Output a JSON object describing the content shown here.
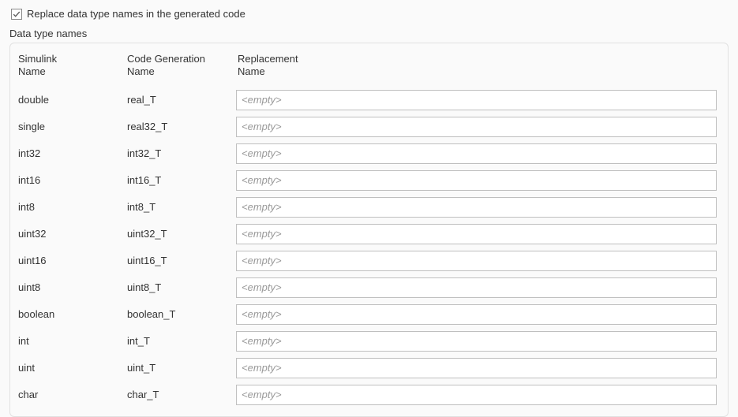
{
  "checkbox": {
    "label": "Replace data type names in the generated code",
    "checked": true
  },
  "section_title": "Data type names",
  "columns": {
    "simulink_l1": "Simulink",
    "simulink_l2": "Name",
    "codegen_l1": "Code Generation",
    "codegen_l2": "Name",
    "replacement_l1": "Replacement",
    "replacement_l2": "Name"
  },
  "placeholder": "<empty>",
  "rows": [
    {
      "simulink": "double",
      "codegen": "real_T",
      "replacement": ""
    },
    {
      "simulink": "single",
      "codegen": "real32_T",
      "replacement": ""
    },
    {
      "simulink": "int32",
      "codegen": "int32_T",
      "replacement": ""
    },
    {
      "simulink": "int16",
      "codegen": "int16_T",
      "replacement": ""
    },
    {
      "simulink": "int8",
      "codegen": "int8_T",
      "replacement": ""
    },
    {
      "simulink": "uint32",
      "codegen": "uint32_T",
      "replacement": ""
    },
    {
      "simulink": "uint16",
      "codegen": "uint16_T",
      "replacement": ""
    },
    {
      "simulink": "uint8",
      "codegen": "uint8_T",
      "replacement": ""
    },
    {
      "simulink": "boolean",
      "codegen": "boolean_T",
      "replacement": ""
    },
    {
      "simulink": "int",
      "codegen": "int_T",
      "replacement": ""
    },
    {
      "simulink": "uint",
      "codegen": "uint_T",
      "replacement": ""
    },
    {
      "simulink": "char",
      "codegen": "char_T",
      "replacement": ""
    }
  ]
}
